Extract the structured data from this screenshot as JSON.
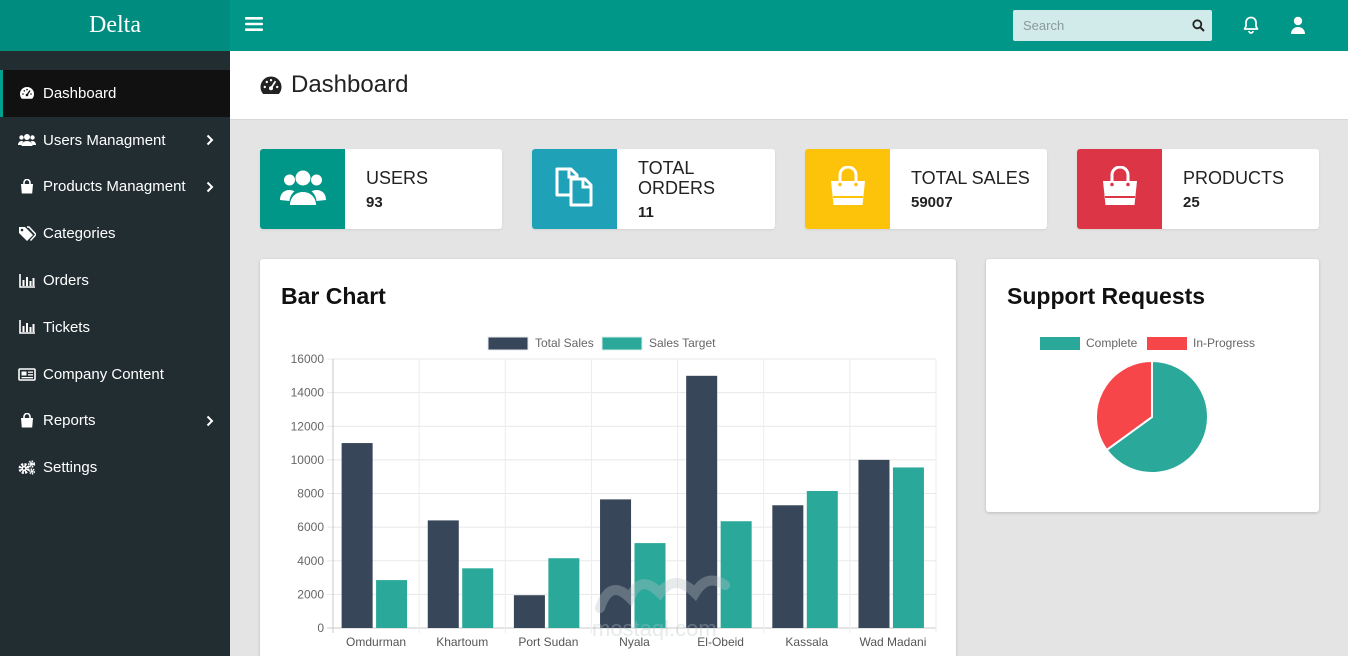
{
  "app": {
    "brand": "Delta"
  },
  "sidebar": {
    "items": [
      {
        "label": "Dashboard",
        "icon": "dashboard-icon",
        "has_submenu": false,
        "active": true
      },
      {
        "label": "Users Managment",
        "icon": "users-icon",
        "has_submenu": true
      },
      {
        "label": "Products Managment",
        "icon": "shopping-bag-icon",
        "has_submenu": true
      },
      {
        "label": "Categories",
        "icon": "tags-icon",
        "has_submenu": false
      },
      {
        "label": "Orders",
        "icon": "bar-chart-icon",
        "has_submenu": false
      },
      {
        "label": "Tickets",
        "icon": "bar-chart-icon",
        "has_submenu": false
      },
      {
        "label": "Company Content",
        "icon": "newspaper-icon",
        "has_submenu": false
      },
      {
        "label": "Reports",
        "icon": "shopping-bag-icon",
        "has_submenu": true
      },
      {
        "label": "Settings",
        "icon": "cogs-icon",
        "has_submenu": false
      }
    ]
  },
  "topbar": {
    "search_placeholder": "Search"
  },
  "page": {
    "title": "Dashboard"
  },
  "stats": [
    {
      "title": "USERS",
      "value": "93",
      "color": "#009688",
      "icon": "users-icon"
    },
    {
      "title": "TOTAL ORDERS",
      "value": "11",
      "color": "#1fa2b8",
      "icon": "copy-icon"
    },
    {
      "title": "TOTAL SALES",
      "value": "59007",
      "color": "#fdc20a",
      "icon": "shopping-bag-icon"
    },
    {
      "title": "PRODUCTS",
      "value": "25",
      "color": "#dc3545",
      "icon": "shopping-bag-icon"
    }
  ],
  "colors": {
    "sidebar": "#222d32",
    "brand": "#008d7f",
    "topbar": "#009688",
    "series_sales": "#374659",
    "series_target": "#2aa89a",
    "complete": "#2aa89a",
    "in_progress": "#f7464a"
  },
  "panels": {
    "bar_title": "Bar Chart",
    "pie_title": "Support Requests"
  },
  "chart_data": [
    {
      "type": "bar",
      "title": "Bar Chart",
      "categories": [
        "Omdurman",
        "Khartoum",
        "Port Sudan",
        "Nyala",
        "El-Obeid",
        "Kassala",
        "Wad Madani"
      ],
      "series": [
        {
          "name": "Total Sales",
          "values": [
            11000,
            6400,
            1950,
            7650,
            15000,
            7300,
            10000
          ]
        },
        {
          "name": "Sales Target",
          "values": [
            2850,
            3550,
            4150,
            5050,
            6350,
            8150,
            9550
          ]
        }
      ],
      "ylim": [
        0,
        16000
      ],
      "yticks": [
        "0",
        "2000",
        "4000",
        "6000",
        "8000",
        "10000",
        "12000",
        "14000",
        "16000"
      ],
      "grid": true,
      "legend": "top-center"
    },
    {
      "type": "pie",
      "title": "Support Requests",
      "labels": [
        "Complete",
        "In-Progress"
      ],
      "values": [
        65,
        35
      ],
      "legend": "top-center"
    }
  ],
  "watermark": {
    "text": "mostaql.com"
  }
}
